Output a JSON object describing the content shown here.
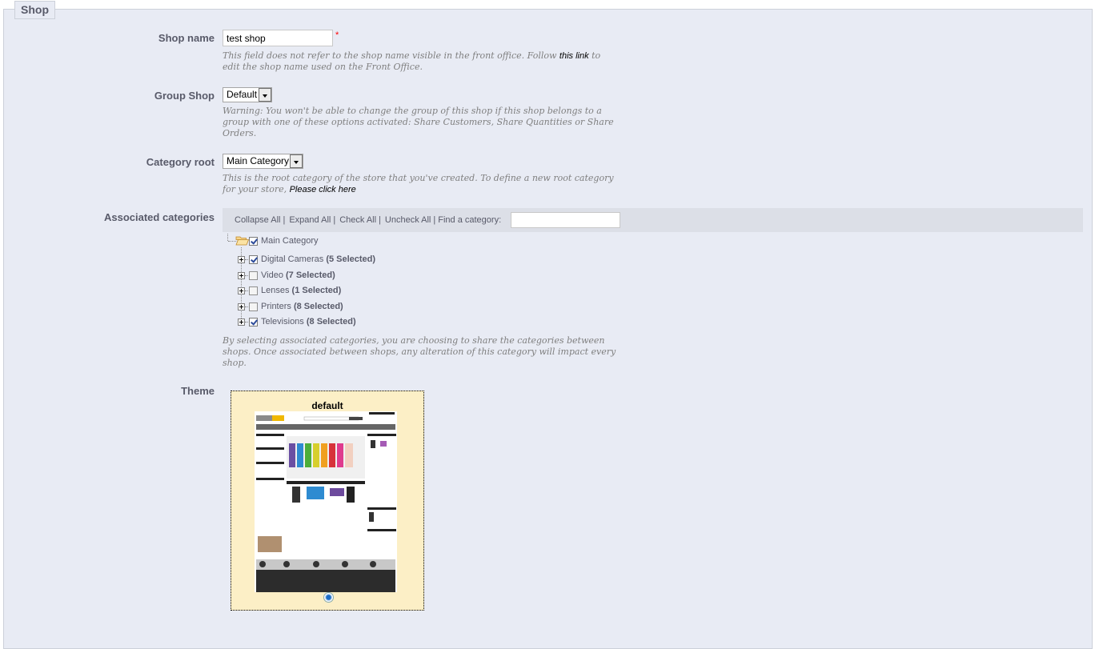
{
  "fieldset": {
    "legend": "Shop"
  },
  "shop_name": {
    "label": "Shop name",
    "value": "test shop",
    "required_mark": "*",
    "hint_before": "This field does not refer to the shop name visible in the front office. Follow ",
    "hint_link": "this link",
    "hint_after": " to edit the shop name used on the Front Office."
  },
  "group_shop": {
    "label": "Group Shop",
    "selected": "Default",
    "hint": "Warning: You won't be able to change the group of this shop if this shop belongs to a group with one of these options activated: Share Customers, Share Quantities or Share Orders."
  },
  "category_root": {
    "label": "Category root",
    "selected": "Main Category",
    "hint_before": "This is the root category of the store that you've created. To define a new root category for your store, ",
    "hint_link": "Please click here"
  },
  "associated_categories": {
    "label": "Associated categories",
    "toolbar": {
      "collapse_all": "Collapse All",
      "expand_all": "Expand All",
      "check_all": "Check All",
      "uncheck_all": "Uncheck All",
      "find_label": "Find a category:",
      "find_value": ""
    },
    "root": {
      "name": "Main Category",
      "checked": true
    },
    "children": [
      {
        "name": "Digital Cameras",
        "count": "(5 Selected)",
        "checked": true
      },
      {
        "name": "Video",
        "count": "(7 Selected)",
        "checked": false
      },
      {
        "name": "Lenses",
        "count": "(1 Selected)",
        "checked": false
      },
      {
        "name": "Printers",
        "count": "(8 Selected)",
        "checked": false
      },
      {
        "name": "Televisions",
        "count": "(8 Selected)",
        "checked": true
      }
    ],
    "hint": "By selecting associated categories, you are choosing to share the categories between shops. Once associated between shops, any alteration of this category will impact every shop."
  },
  "theme": {
    "label": "Theme",
    "name": "default",
    "selected": true
  }
}
